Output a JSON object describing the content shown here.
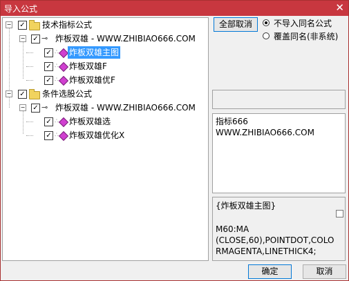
{
  "window": {
    "title": "导入公式",
    "close_glyph": "✕"
  },
  "tree": {
    "groups": [
      {
        "label": "技术指标公式",
        "parent": {
          "label": "炸板双雄 - WWW.ZHIBIAO666.COM"
        },
        "items": [
          "炸板双雄主图",
          "炸板双雄F",
          "炸板双雄优F"
        ]
      },
      {
        "label": "条件选股公式",
        "parent": {
          "label": "炸板双雄 - WWW.ZHIBIAO666.COM"
        },
        "items": [
          "炸板双雄选",
          "炸板双雄优化X"
        ]
      }
    ],
    "selected_item": "炸板双雄主图",
    "check_glyph": "✓",
    "expander_glyph": "−"
  },
  "controls": {
    "deselect_all_label": "全部取消",
    "radio_options": [
      {
        "label": "不导入同名公式",
        "selected": true
      },
      {
        "label": "覆盖同名(非系统)",
        "selected": false
      }
    ]
  },
  "info": {
    "line1": "指标666",
    "line2": "WWW.ZHIBIAO666.COM"
  },
  "formula": {
    "name": "{炸板双雄主图}",
    "code_lines": [
      "M60:MA",
      "(CLOSE,60),POINTDOT,COLO",
      "RMAGENTA,LINETHICK4;"
    ]
  },
  "footer": {
    "ok_label": "确定",
    "cancel_label": "取消"
  }
}
